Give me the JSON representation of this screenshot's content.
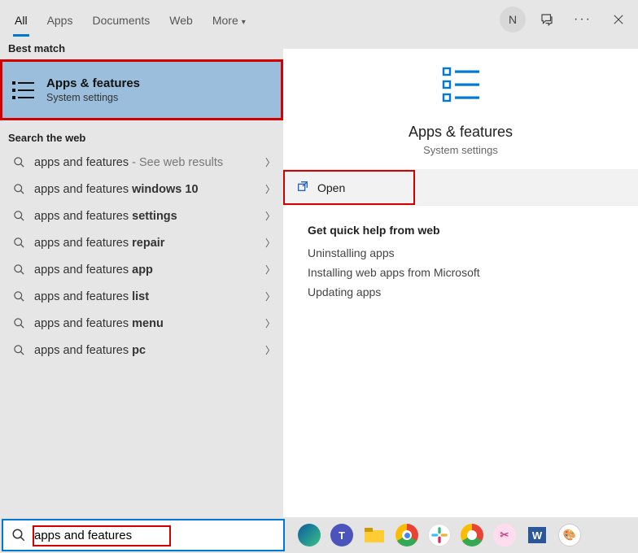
{
  "tabs": {
    "all": "All",
    "apps": "Apps",
    "documents": "Documents",
    "web": "Web",
    "more": "More"
  },
  "user": {
    "initial": "N"
  },
  "sections": {
    "best_match": "Best match",
    "search_web": "Search the web"
  },
  "best_match": {
    "title": "Apps & features",
    "subtitle": "System settings"
  },
  "web_results": [
    {
      "prefix": "apps and features",
      "bold": "",
      "suffix": " - See web results"
    },
    {
      "prefix": "apps and features ",
      "bold": "windows 10",
      "suffix": ""
    },
    {
      "prefix": "apps and features ",
      "bold": "settings",
      "suffix": ""
    },
    {
      "prefix": "apps and features ",
      "bold": "repair",
      "suffix": ""
    },
    {
      "prefix": "apps and features ",
      "bold": "app",
      "suffix": ""
    },
    {
      "prefix": "apps and features ",
      "bold": "list",
      "suffix": ""
    },
    {
      "prefix": "apps and features ",
      "bold": "menu",
      "suffix": ""
    },
    {
      "prefix": "apps and features ",
      "bold": "pc",
      "suffix": ""
    }
  ],
  "preview": {
    "title": "Apps & features",
    "subtitle": "System settings",
    "open": "Open",
    "quick_help_header": "Get quick help from web",
    "help_links": [
      "Uninstalling apps",
      "Installing web apps from Microsoft",
      "Updating apps"
    ]
  },
  "search": {
    "value": "apps and features"
  }
}
